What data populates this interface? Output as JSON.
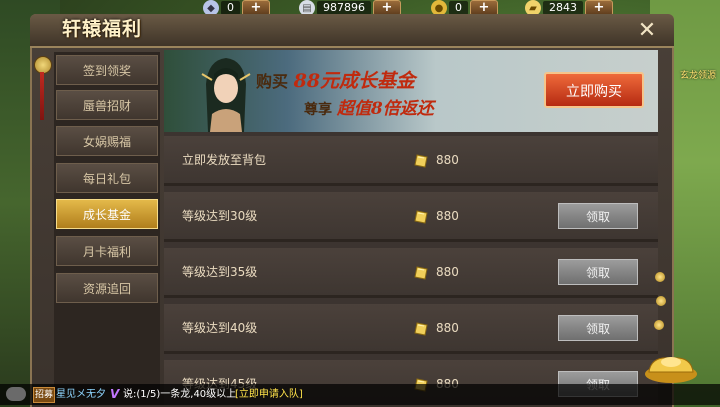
{
  "resources": [
    {
      "icon": "diamond-icon",
      "value": "0"
    },
    {
      "icon": "silver-icon",
      "value": "987896"
    },
    {
      "icon": "coin-icon",
      "value": "0"
    },
    {
      "icon": "gold-ingot-icon",
      "value": "2843"
    }
  ],
  "plus_label": "+",
  "window": {
    "title": "轩辕福利",
    "close_label": "✕"
  },
  "sidebar": {
    "items": [
      {
        "label": "签到领奖"
      },
      {
        "label": "蜃兽招财"
      },
      {
        "label": "女娲赐福"
      },
      {
        "label": "每日礼包"
      },
      {
        "label": "成长基金"
      },
      {
        "label": "月卡福利"
      },
      {
        "label": "资源追回"
      }
    ],
    "active_index": 4
  },
  "banner": {
    "line1_prefix": "购买",
    "line1_highlight": "88元成长基金",
    "line2_prefix": "尊享",
    "line2_highlight": "超值8倍返还",
    "buy_label": "立即购买"
  },
  "rows": [
    {
      "label": "立即发放至背包",
      "amount": "880",
      "button": ""
    },
    {
      "label": "等级达到30级",
      "amount": "880",
      "button": "领取"
    },
    {
      "label": "等级达到35级",
      "amount": "880",
      "button": "领取"
    },
    {
      "label": "等级达到40级",
      "amount": "880",
      "button": "领取"
    },
    {
      "label": "等级达到45级",
      "amount": "880",
      "button": "领取"
    }
  ],
  "corner_label": "玄龙领源",
  "chat": {
    "tag": "招募",
    "name": "星见メ无夕",
    "vip": "V",
    "message": "说:(1/5)一条龙,40级以上",
    "link": "[立即申请入队]"
  },
  "colors": {
    "accent_gold": "#e4b94a",
    "buy_red": "#d2421e",
    "claim_gray": "#8a8a8a"
  }
}
